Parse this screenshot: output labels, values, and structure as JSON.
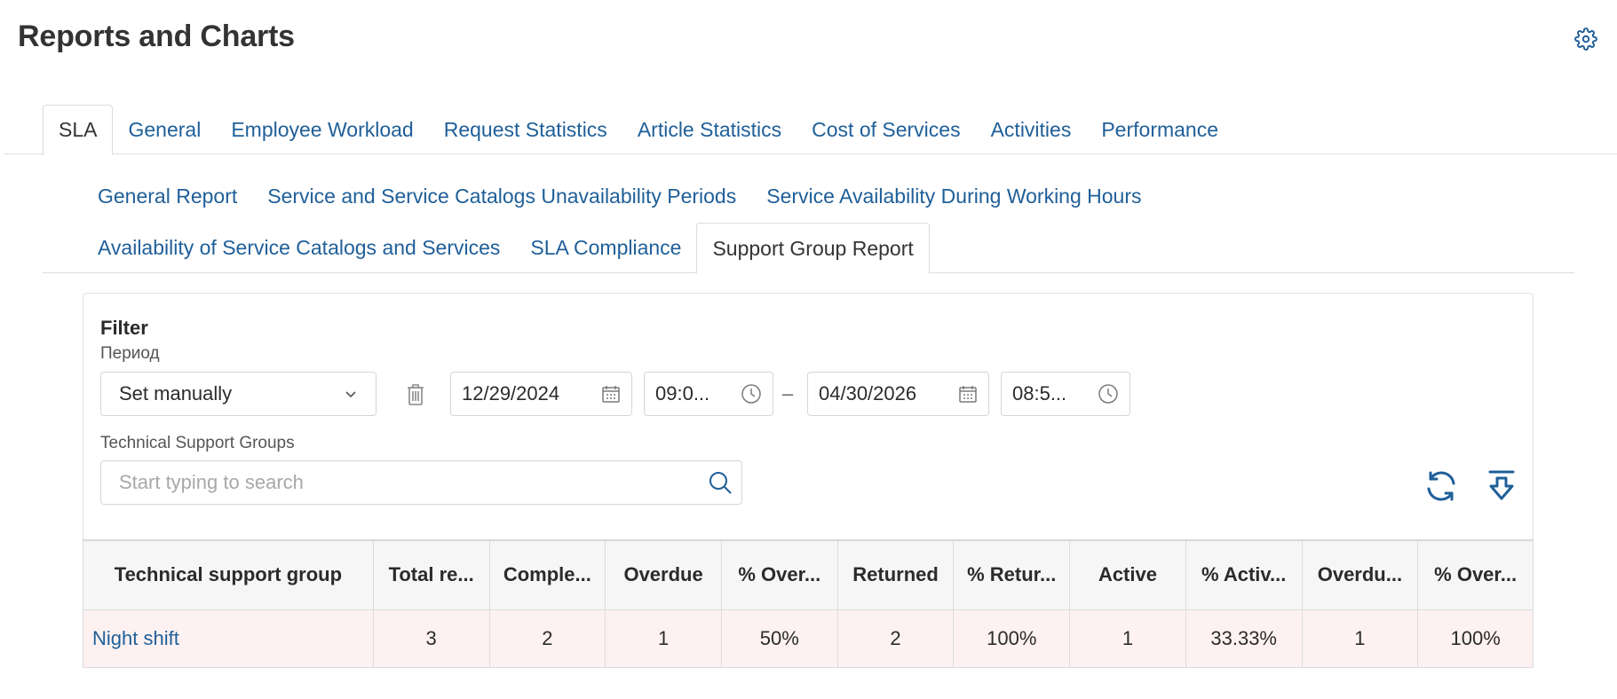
{
  "page": {
    "title": "Reports and Charts"
  },
  "main_tabs": [
    {
      "label": "SLA",
      "active": true
    },
    {
      "label": "General"
    },
    {
      "label": "Employee Workload"
    },
    {
      "label": "Request Statistics"
    },
    {
      "label": "Article Statistics"
    },
    {
      "label": "Cost of Services"
    },
    {
      "label": "Activities"
    },
    {
      "label": "Performance"
    }
  ],
  "sub_tabs": {
    "row1": [
      {
        "label": "General Report"
      },
      {
        "label": "Service and Service Catalogs Unavailability Periods"
      },
      {
        "label": "Service Availability During Working Hours"
      }
    ],
    "row2": [
      {
        "label": "Availability of Service Catalogs and Services"
      },
      {
        "label": "SLA Compliance"
      },
      {
        "label": "Support Group Report",
        "active": true
      }
    ]
  },
  "filter": {
    "title": "Filter",
    "period_label": "Период",
    "period_value": "Set manually",
    "date_from": "12/29/2024",
    "time_from": "09:0...",
    "date_to": "04/30/2026",
    "time_to": "08:5...",
    "range_separator": "–",
    "groups_label": "Technical Support Groups",
    "search_placeholder": "Start typing to search"
  },
  "table": {
    "headers": [
      "Technical support group",
      "Total re...",
      "Comple...",
      "Overdue",
      "% Over...",
      "Returned",
      "% Retur...",
      "Active",
      "% Activ...",
      "Overdu...",
      "% Over..."
    ],
    "rows": [
      [
        "Night shift",
        "3",
        "2",
        "1",
        "50%",
        "2",
        "100%",
        "1",
        "33.33%",
        "1",
        "100%"
      ]
    ]
  },
  "colors": {
    "link": "#1f5f99",
    "highlight_row": "#fdf1f1",
    "header_bg": "#f6f6f6"
  },
  "icons": [
    "settings-gear-icon",
    "chevron-down-icon",
    "trash-icon",
    "calendar-icon",
    "clock-icon",
    "search-icon",
    "refresh-icon",
    "download-icon"
  ]
}
